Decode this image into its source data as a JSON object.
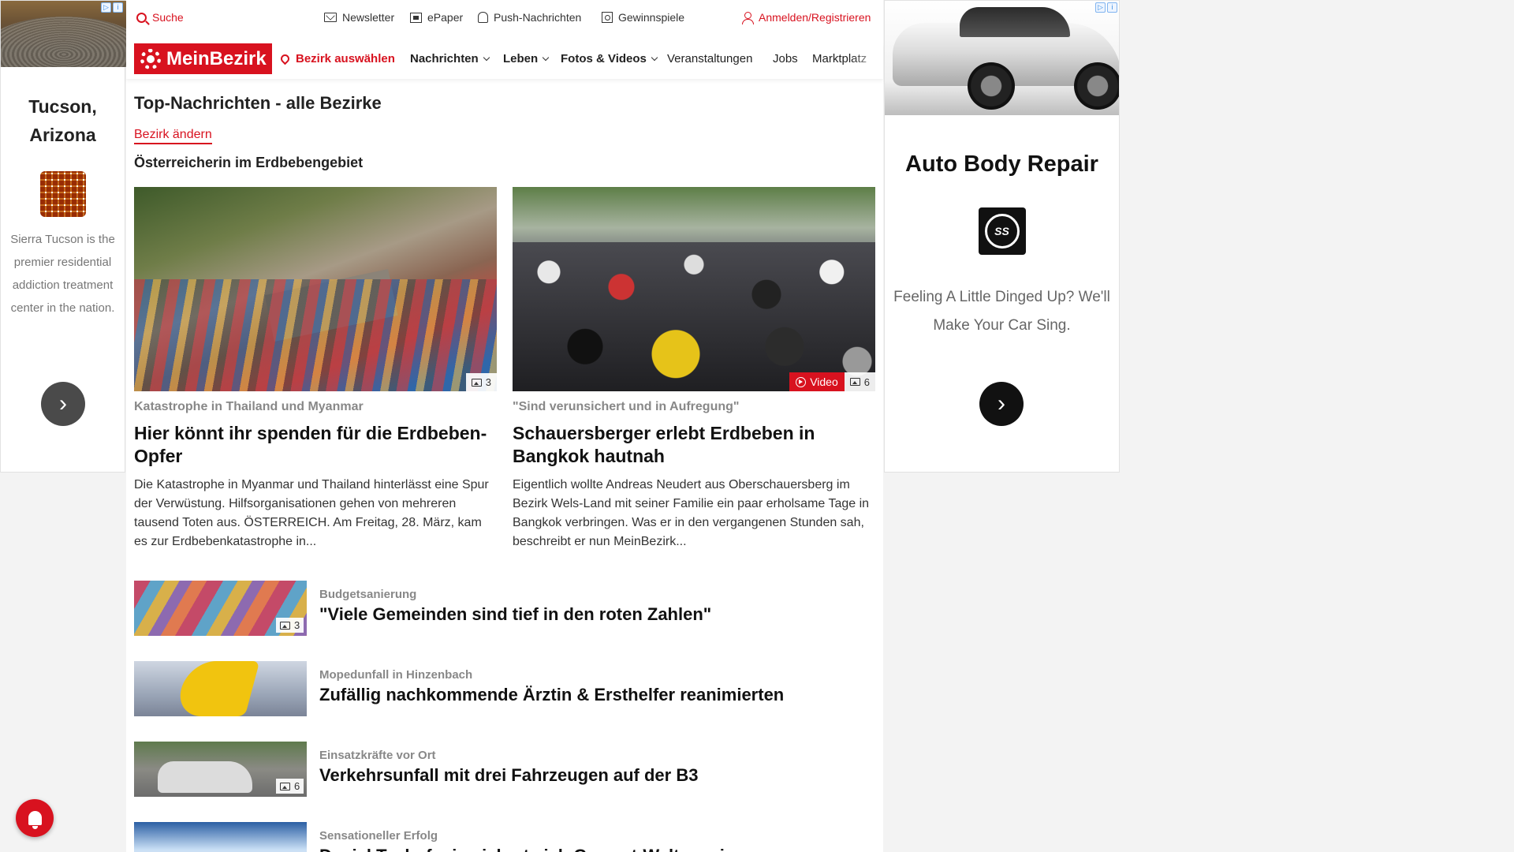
{
  "ads": {
    "left": {
      "title": "Tucson, Arizona",
      "text": "Sierra Tucson is the premier residential addiction treatment center in the nation.",
      "arrow_icon": "chevron-right-icon"
    },
    "right": {
      "title": "Auto Body Repair",
      "logo_text": "SS",
      "text": "Feeling A Little Dinged Up? We'll Make Your Car Sing.",
      "arrow_icon": "chevron-right-icon"
    }
  },
  "topbar": {
    "search": "Suche",
    "newsletter": "Newsletter",
    "epaper": "ePaper",
    "push": "Push-Nachrichten",
    "gewinnspiele": "Gewinnspiele",
    "login": "Anmelden/Registrieren"
  },
  "nav": {
    "logo": "MeinBezirk",
    "bezirk": "Bezirk auswählen",
    "items": [
      "Nachrichten",
      "Leben",
      "Fotos & Videos",
      "Veranstaltungen",
      "Jobs",
      "Marktplatz"
    ]
  },
  "main": {
    "title": "Top-Nachrichten - alle Bezirke",
    "change_link": "Bezirk ändern",
    "topic": "Österreicherin im Erdbebengebiet",
    "cards": [
      {
        "kicker": "Katastrophe in Thailand und Myanmar",
        "headline": "Hier könnt ihr spenden für die Erdbeben-Opfer",
        "teaser": "Die Katastrophe in Myanmar und Thailand hinterlässt eine Spur der Verwüstung. Hilfsorganisationen gehen von mehreren tausend Toten aus.  ÖSTERREICH. Am Freitag, 28. März, kam es zur Erdbebenkatastrophe in...",
        "image_count": "3"
      },
      {
        "kicker": "\"Sind verunsichert und in Aufregung\"",
        "headline": "Schauersberger erlebt Erdbeben in Bangkok hautnah",
        "teaser": "Eigentlich wollte Andreas Neudert aus Oberschauersberg im Bezirk Wels-Land mit seiner Familie ein paar erholsame Tage in Bangkok verbringen. Was er in den vergangenen Stunden sah, beschreibt er nun MeinBezirk...",
        "video_label": "Video",
        "image_count": "6"
      }
    ],
    "list": [
      {
        "kicker": "Budgetsanierung",
        "headline": "\"Viele Gemeinden sind tief in den roten Zahlen\"",
        "image_count": "3"
      },
      {
        "kicker": "Mopedunfall in Hinzenbach",
        "headline": "Zufällig nachkommende Ärztin & Ersthelfer reanimierten"
      },
      {
        "kicker": "Einsatzkräfte vor Ort",
        "headline": "Verkehrsunfall mit drei Fahrzeugen auf der B3",
        "image_count": "6"
      },
      {
        "kicker": "Sensationeller Erfolg",
        "headline": "Daniel Tschofenig sichert sich Gesamt-Weltcupsieg"
      }
    ]
  },
  "colors": {
    "brand_red": "#d8121f"
  }
}
